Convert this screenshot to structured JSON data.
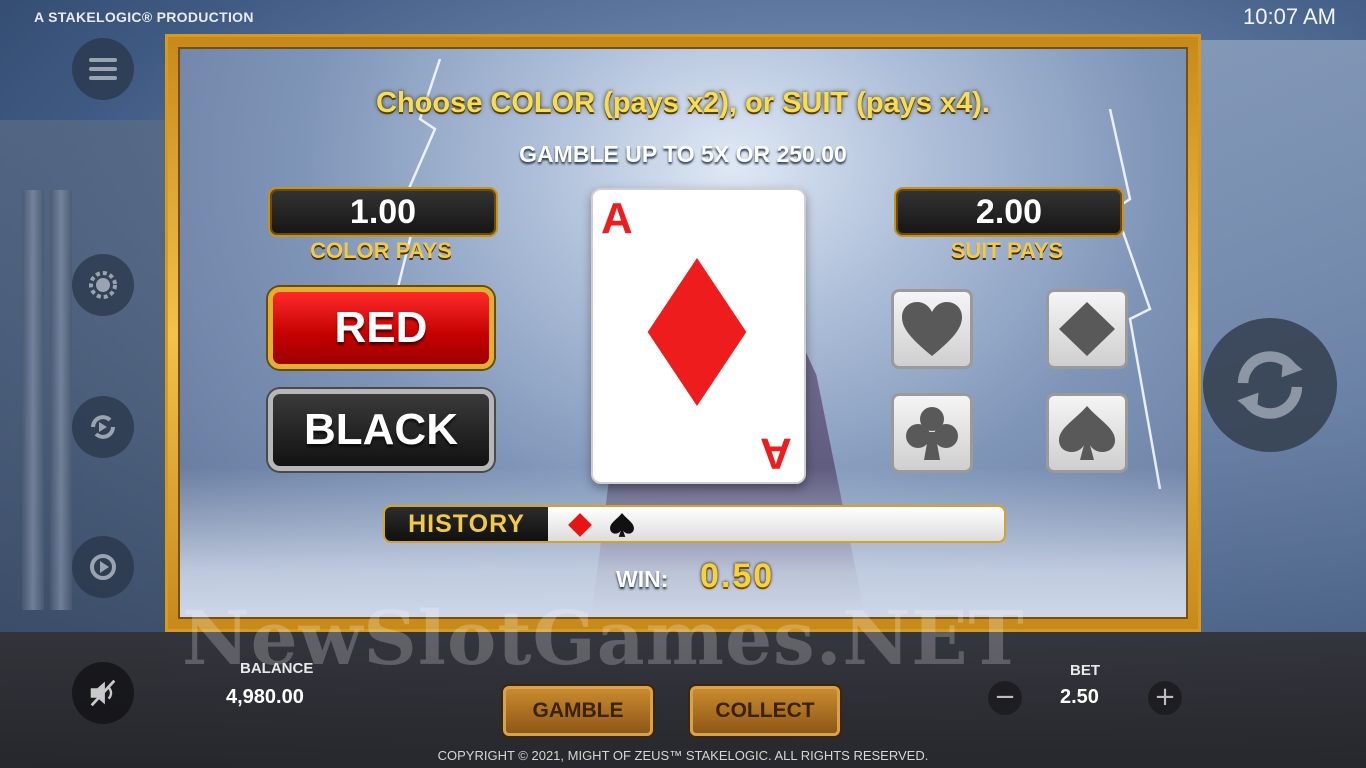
{
  "top": {
    "brand": "A STAKELOGIC® PRODUCTION",
    "clock": "10:07 AM"
  },
  "gamble": {
    "headline": "Choose COLOR (pays x2), or SUIT (pays x4).",
    "subline": "GAMBLE UP TO 5X OR 250.00",
    "color_pays_value": "1.00",
    "color_pays_label": "COLOR PAYS",
    "suit_pays_value": "2.00",
    "suit_pays_label": "SUIT PAYS",
    "red_label": "RED",
    "black_label": "BLACK",
    "card": {
      "rank": "A",
      "suit": "diamond",
      "color": "#ee1c1c"
    },
    "suits": [
      "heart",
      "diamond",
      "club",
      "spade"
    ],
    "history_label": "HISTORY",
    "history": [
      "diamond",
      "spade"
    ],
    "win_label": "WIN:",
    "win_value": "0.50"
  },
  "bottom": {
    "balance_label": "BALANCE",
    "balance_value": "4,980.00",
    "bet_label": "BET",
    "bet_value": "2.50",
    "minus": "−",
    "plus": "+",
    "gamble_label": "GAMBLE",
    "collect_label": "COLLECT",
    "copyright": "COPYRIGHT © 2021, MIGHT OF ZEUS™ STAKELOGIC. ALL RIGHTS RESERVED."
  },
  "watermark": "NewSlotGames.NET",
  "colors": {
    "gold": "#f2c94a",
    "red_button": "#c40000",
    "card_red": "#ee1c1c"
  }
}
